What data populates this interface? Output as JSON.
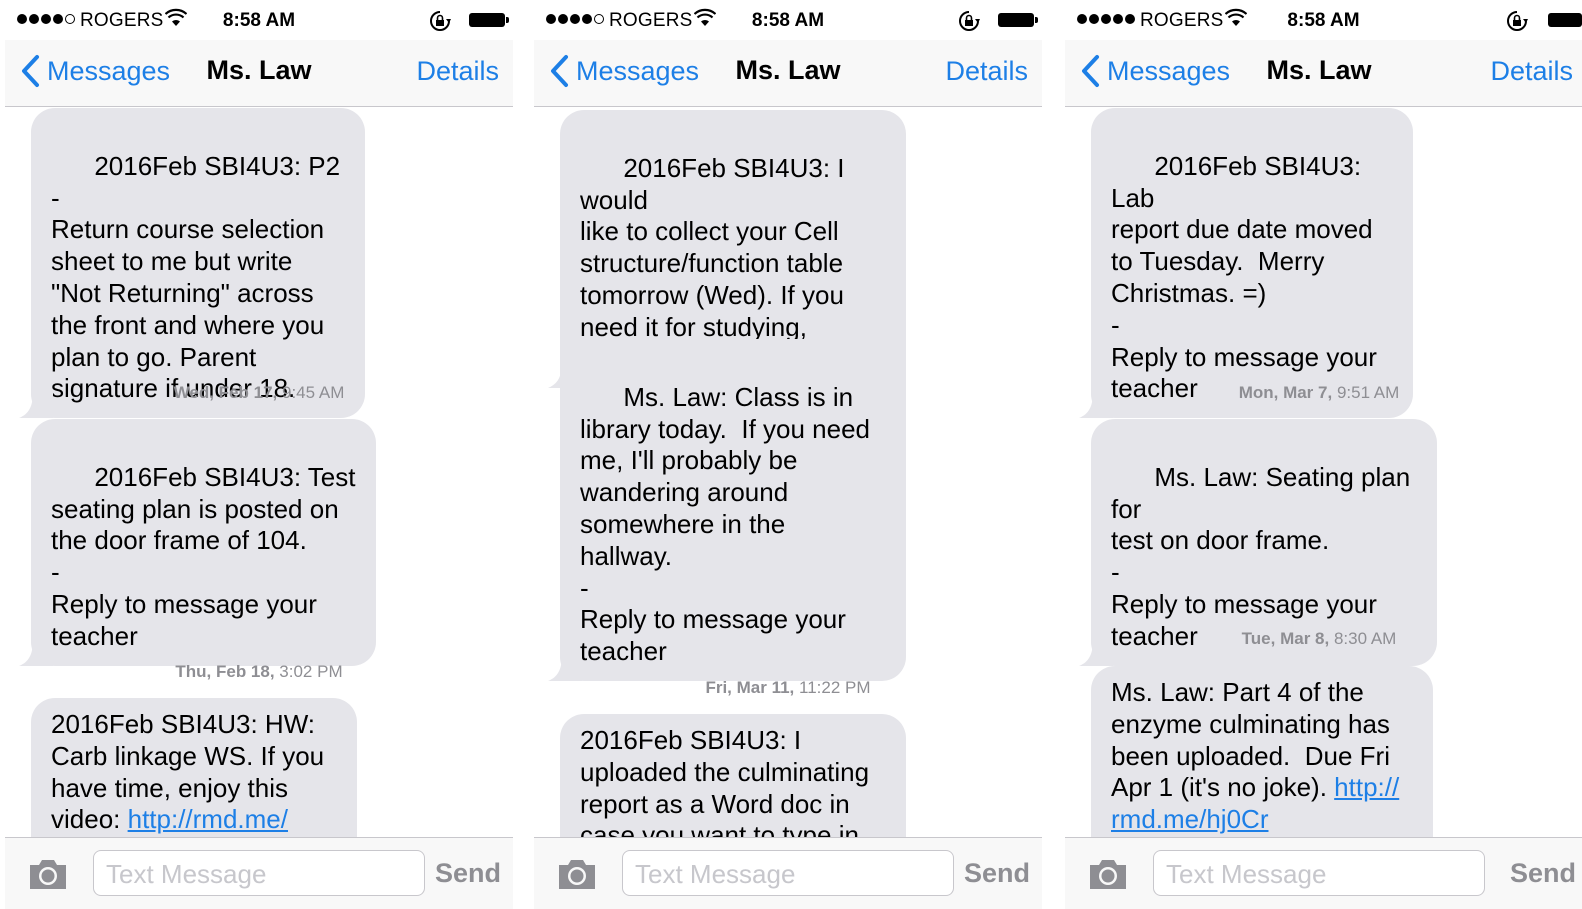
{
  "status_bar": {
    "carrier": "ROGERS",
    "time": "8:58 AM"
  },
  "nav": {
    "back_label": "Messages",
    "title": "Ms. Law",
    "details_label": "Details"
  },
  "composer": {
    "placeholder": "Text Message",
    "send_label": "Send"
  },
  "colors": {
    "accent": "#1d7fe6",
    "bubble": "#e5e5ea",
    "meta_text": "#8e8e93"
  },
  "icons": [
    "signal-dots-icon",
    "wifi-icon",
    "orientation-lock-icon",
    "battery-icon",
    "chevron-left-icon",
    "camera-icon"
  ],
  "screens": [
    {
      "messages": [
        {
          "text": "2016Feb SBI4U3: P2 -\nReturn course selection\nsheet to me but write\n\"Not Returning\" across\nthe front and where you\nplan to go. Parent\nsignature if under 18."
        },
        {
          "timestamp_day": "Wed, Feb 17,",
          "timestamp_time": "9:45 AM"
        },
        {
          "text": "2016Feb SBI4U3: Test\nseating plan is posted on\nthe door frame of 104.\n-\nReply to message your\nteacher"
        },
        {
          "timestamp_day": "Thu, Feb 18,",
          "timestamp_time": "3:02 PM"
        },
        {
          "text": "2016Feb SBI4U3: HW:\nCarb linkage WS. If you\nhave time, enjoy this\nvideo: ",
          "link": "http://rmd.me/"
        }
      ]
    },
    {
      "messages": [
        {
          "text": "2016Feb SBI4U3: I would\nlike to collect your Cell\nstructure/function table\ntomorrow (Wed). If you\nneed it for studying,\nplease make a copy of it."
        },
        {
          "text": "Ms. Law: Class is in\nlibrary today.  If you need\nme, I'll probably be\nwandering around\nsomewhere in the\nhallway.\n-\nReply to message your\nteacher"
        },
        {
          "timestamp_day": "Fri, Mar 11,",
          "timestamp_time": "11:22 PM"
        },
        {
          "text": "2016Feb SBI4U3: I\nuploaded the culminating\nreport as a Word doc in\ncase you want to type in"
        }
      ]
    },
    {
      "messages": [
        {
          "text": "2016Feb SBI4U3: Lab\nreport due date moved\nto Tuesday.  Merry\nChristmas. =)\n-\nReply to message your\nteacher"
        },
        {
          "timestamp_day": "Mon, Mar 7,",
          "timestamp_time": "9:51 AM"
        },
        {
          "text": "Ms. Law: Seating plan for\ntest on door frame.\n-\nReply to message your\nteacher"
        },
        {
          "timestamp_day": "Tue, Mar 8,",
          "timestamp_time": "8:30 AM"
        },
        {
          "text": "Ms. Law: Part 4 of the\nenzyme culminating has\nbeen uploaded.  Due Fri\nApr 1 (it's no joke). ",
          "link": "http://\nrmd.me/hj0Cr"
        }
      ]
    }
  ]
}
